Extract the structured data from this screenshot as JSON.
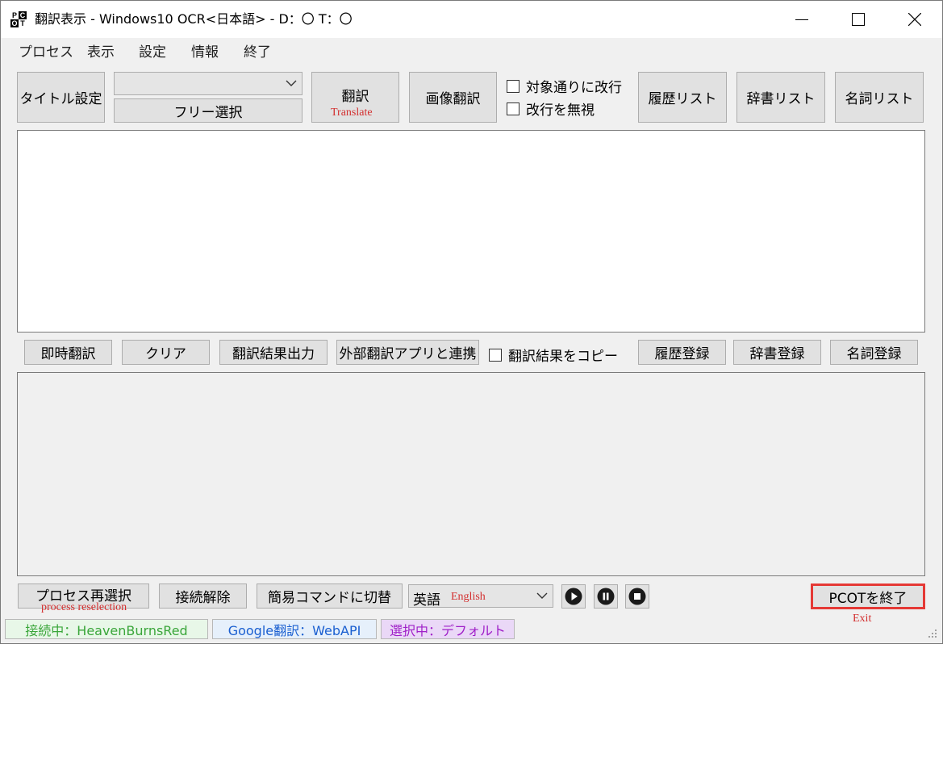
{
  "window": {
    "title": "翻訳表示 - Windows10 OCR<日本語> - D：〇 T：〇",
    "icon_letters": [
      "P",
      "C",
      "O",
      "T"
    ],
    "controls": [
      "minimize-icon",
      "maximize-icon",
      "close-icon"
    ]
  },
  "menu": [
    "プロセス",
    "表示",
    "設定",
    "情報",
    "終了"
  ],
  "toolbar": {
    "title_setting": "タイトル設定",
    "combo_value": "",
    "free_select": "フリー選択",
    "translate": "翻訳",
    "translate_note": "Translate",
    "image_translate": "画像翻訳",
    "checkbox_linebreak": "対象通りに改行",
    "checkbox_ignore": "改行を無視",
    "history_list": "履歴リスト",
    "dict_list": "辞書リスト",
    "noun_list": "名詞リスト"
  },
  "midbar": {
    "instant": "即時翻訳",
    "clear": "クリア",
    "output": "翻訳結果出力",
    "external": "外部翻訳アプリと連携",
    "copy_checkbox": "翻訳結果をコピー",
    "history_reg": "履歴登録",
    "dict_reg": "辞書登録",
    "noun_reg": "名詞登録"
  },
  "bottombar": {
    "reselect": "プロセス再選択",
    "reselect_note": "process reselection",
    "disconnect": "接続解除",
    "simple_cmd": "簡易コマンドに切替",
    "lang_value": "英語",
    "lang_note": "English",
    "media_icons": [
      "play-icon",
      "pause-icon",
      "stop-icon"
    ],
    "exit": "PCOTを終了",
    "exit_note": "Exit"
  },
  "status": {
    "connection": "接続中：HeavenBurnsRed",
    "engine": "Google翻訳：WebAPI",
    "selection": "選択中：デフォルト"
  },
  "colors": {
    "annotation": "#d32f2f",
    "highlight": "#e53935",
    "status_connection": "#3aa63a",
    "status_engine": "#1a5fd0",
    "status_selection": "#a020c8"
  }
}
